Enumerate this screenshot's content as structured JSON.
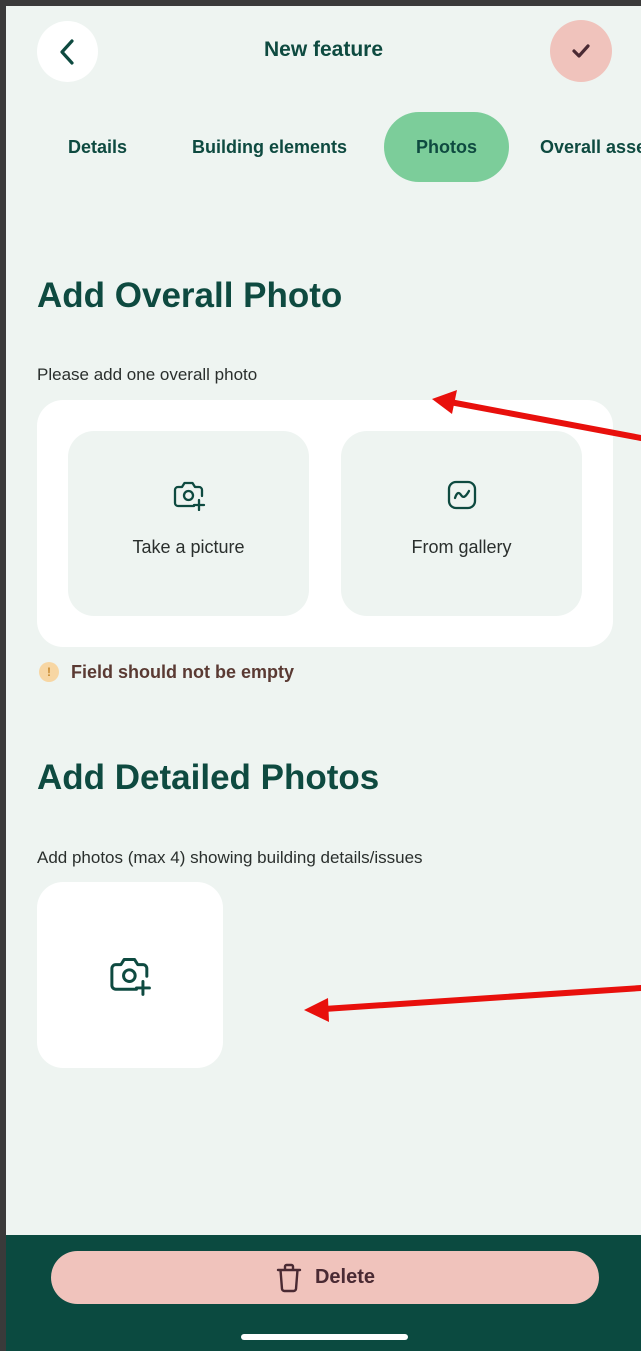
{
  "header": {
    "title": "New feature"
  },
  "tabs": [
    {
      "label": "Details"
    },
    {
      "label": "Building elements"
    },
    {
      "label": "Photos",
      "active": true
    },
    {
      "label": "Overall assessment"
    }
  ],
  "overall_section": {
    "heading": "Add Overall Photo",
    "subtitle": "Please add one overall photo",
    "take_picture_label": "Take a picture",
    "gallery_label": "From gallery",
    "error_text": "Field should not be empty"
  },
  "detailed_section": {
    "heading": "Add Detailed Photos",
    "subtitle": "Add photos (max 4) showing building details/issues"
  },
  "footer": {
    "delete_label": "Delete"
  },
  "icons": [
    "back-icon",
    "check-icon",
    "camera-plus-icon",
    "gallery-icon",
    "warning-icon",
    "trash-icon"
  ],
  "colors": {
    "primary": "#0e4a40",
    "active_tab": "#7ccd9a",
    "danger_soft": "#f0c3bc",
    "background": "#eef4f1",
    "annotation_arrow": "#e8100c"
  }
}
